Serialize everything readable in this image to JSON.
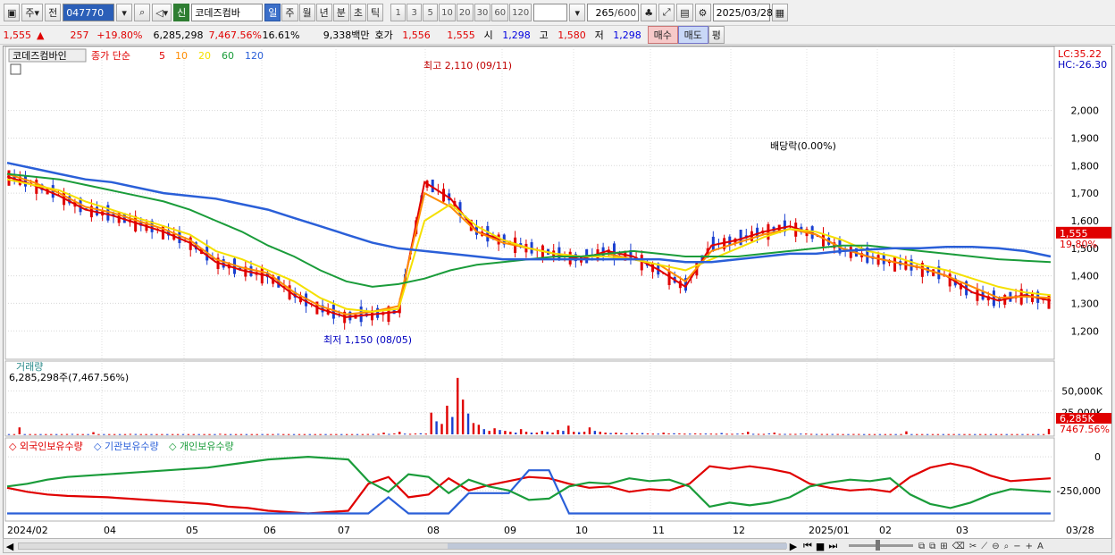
{
  "toolbar": {
    "period": "주",
    "prev_label": "전",
    "code": "047770",
    "shin": "신",
    "name": "코데즈컴바",
    "intervals": [
      "일",
      "주",
      "월",
      "년",
      "분",
      "초",
      "틱"
    ],
    "selected_interval": "일",
    "numbers": [
      "1",
      "3",
      "5",
      "10",
      "20",
      "30",
      "60",
      "120"
    ],
    "count": "265",
    "total": "/600",
    "date": "2025/03/28"
  },
  "quote": {
    "price": "1,555",
    "arrow": "▲",
    "change": "257",
    "change_pct": "+19.80%",
    "volume": "6,285,298",
    "vol_pct": "7,467.56%",
    "turnover": "16.61%",
    "amount": "9,338백만",
    "bid_label": "호가",
    "bid1": "1,556",
    "bid2": "1,555",
    "open_label": "시",
    "open": "1,298",
    "high_label": "고",
    "high": "1,580",
    "low_label": "저",
    "low": "1,298",
    "buy": "매수",
    "sell": "매도",
    "eval": "평"
  },
  "legend": {
    "name": "코데즈컴바인",
    "ma_label": "종가 단순",
    "ma": [
      {
        "label": "5",
        "color": "#e00000"
      },
      {
        "label": "10",
        "color": "#ff8c00"
      },
      {
        "label": "20",
        "color": "#f5e000"
      },
      {
        "label": "60",
        "color": "#1a9c3a"
      },
      {
        "label": "120",
        "color": "#2a5fd8"
      }
    ]
  },
  "annotations": {
    "high": "최고 2,110 (09/11)",
    "low": "최저 1,150 (08/05)",
    "dividend": "배당락(0.00%)",
    "lc": "LC:35.22",
    "hc": "HC:-26.30",
    "last_price": "1,555",
    "last_pct": "19.80%",
    "vol_last": "6,285K",
    "vol_last_pct": "7467.56%"
  },
  "volume_panel": {
    "title": "거래량",
    "value": "6,285,298주(7,467.56%)"
  },
  "holder_panel": {
    "series": [
      "외국인보유수량",
      "기관보유수량",
      "개인보유수량"
    ]
  },
  "colors": {
    "up": "#e00000",
    "down": "#1a3fd0",
    "foreign": "#e00000",
    "institution": "#2a5fd8",
    "individual": "#1a9c3a"
  },
  "chart_data": [
    {
      "type": "line",
      "title": "코데즈컴바인",
      "x": [
        "2024/02",
        "04",
        "05",
        "06",
        "07",
        "08",
        "09",
        "10",
        "11",
        "12",
        "2025/01",
        "02",
        "03",
        "03/28"
      ],
      "ylim": [
        1110,
        2200
      ],
      "yticks": [
        1200,
        1300,
        1400,
        1500,
        1600,
        1700,
        1800,
        1900,
        2000
      ],
      "series": [
        {
          "name": "5",
          "values": [
            1760,
            1730,
            1690,
            1640,
            1620,
            1590,
            1560,
            1520,
            1450,
            1420,
            1400,
            1330,
            1280,
            1250,
            1260,
            1270,
            1740,
            1680,
            1560,
            1530,
            1500,
            1480,
            1460,
            1490,
            1470,
            1420,
            1360,
            1510,
            1530,
            1560,
            1580,
            1550,
            1500,
            1470,
            1450,
            1430,
            1400,
            1340,
            1310,
            1330,
            1310
          ]
        },
        {
          "name": "10",
          "values": [
            1770,
            1740,
            1700,
            1650,
            1630,
            1600,
            1570,
            1530,
            1460,
            1430,
            1410,
            1340,
            1290,
            1260,
            1270,
            1290,
            1700,
            1650,
            1560,
            1520,
            1500,
            1480,
            1470,
            1480,
            1460,
            1440,
            1380,
            1490,
            1520,
            1550,
            1570,
            1550,
            1500,
            1470,
            1450,
            1430,
            1400,
            1360,
            1320,
            1325,
            1320
          ]
        },
        {
          "name": "20",
          "values": [
            1750,
            1730,
            1710,
            1670,
            1640,
            1610,
            1580,
            1550,
            1490,
            1460,
            1420,
            1380,
            1320,
            1280,
            1270,
            1280,
            1600,
            1660,
            1580,
            1530,
            1500,
            1480,
            1470,
            1470,
            1460,
            1440,
            1420,
            1460,
            1500,
            1540,
            1570,
            1560,
            1530,
            1490,
            1470,
            1440,
            1420,
            1390,
            1360,
            1340,
            1330
          ]
        },
        {
          "name": "60",
          "values": [
            1770,
            1760,
            1750,
            1730,
            1710,
            1690,
            1670,
            1640,
            1600,
            1560,
            1510,
            1470,
            1420,
            1380,
            1360,
            1370,
            1390,
            1420,
            1440,
            1450,
            1460,
            1470,
            1470,
            1480,
            1490,
            1480,
            1470,
            1470,
            1470,
            1480,
            1490,
            1500,
            1510,
            1510,
            1500,
            1490,
            1480,
            1470,
            1460,
            1455,
            1450
          ]
        },
        {
          "name": "120",
          "values": [
            1810,
            1790,
            1770,
            1750,
            1740,
            1720,
            1700,
            1690,
            1680,
            1660,
            1640,
            1610,
            1580,
            1550,
            1520,
            1500,
            1490,
            1480,
            1470,
            1460,
            1460,
            1460,
            1460,
            1460,
            1460,
            1460,
            1450,
            1450,
            1460,
            1470,
            1480,
            1480,
            1490,
            1495,
            1500,
            1500,
            1505,
            1505,
            1500,
            1490,
            1470
          ]
        }
      ]
    },
    {
      "type": "bar",
      "title": "거래량",
      "ylim": [
        0,
        70000
      ],
      "yticks": [
        25000,
        50000
      ],
      "values": [
        300,
        300,
        8000,
        300,
        300,
        300,
        300,
        300,
        300,
        300,
        300,
        400,
        500,
        300,
        300,
        300,
        2500,
        300,
        300,
        300,
        300,
        300,
        300,
        500,
        400,
        300,
        300,
        300,
        300,
        300,
        300,
        300,
        300,
        300,
        300,
        300,
        300,
        300,
        300,
        300,
        600,
        300,
        300,
        300,
        300,
        300,
        300,
        300,
        300,
        300,
        300,
        500,
        300,
        300,
        300,
        300,
        300,
        300,
        300,
        300,
        300,
        300,
        300,
        300,
        300,
        300,
        300,
        300,
        400,
        400,
        500,
        2000,
        500,
        1000,
        3000,
        800,
        600,
        900,
        1200,
        800,
        25000,
        15000,
        12000,
        33000,
        20000,
        65000,
        40000,
        24000,
        13000,
        11000,
        6000,
        4000,
        7000,
        5000,
        4000,
        3000,
        2000,
        6000,
        3000,
        2000,
        2000,
        4000,
        3000,
        2000,
        5000,
        4000,
        10000,
        3000,
        2500,
        3000,
        8000,
        4000,
        3000,
        2000,
        1500,
        2000,
        1500,
        1000,
        2000,
        1000,
        1500,
        1000,
        800,
        800,
        2000,
        1000,
        1200,
        1000,
        800,
        800,
        1000,
        800,
        900,
        800,
        700,
        1500,
        700,
        600,
        800,
        1200,
        3000,
        600,
        500,
        500,
        1000,
        2000,
        500,
        500,
        500,
        500,
        800,
        800,
        500,
        400,
        400,
        400,
        400,
        400,
        300,
        300,
        400,
        400,
        300,
        300,
        300,
        300,
        300,
        300,
        300,
        300,
        3500,
        300,
        300,
        300,
        300,
        300,
        300,
        300,
        300,
        300,
        300,
        300,
        300,
        300,
        300,
        300,
        300,
        300,
        300,
        300,
        300,
        300,
        300,
        300,
        300,
        300,
        300,
        6285
      ]
    },
    {
      "type": "line",
      "title": "보유수량",
      "ylim": [
        -450000,
        100000
      ],
      "yticks": [
        0,
        -250000
      ],
      "series": [
        {
          "name": "외국인보유수량",
          "values": [
            -230000,
            -260000,
            -280000,
            -290000,
            -295000,
            -300000,
            -310000,
            -320000,
            -330000,
            -340000,
            -350000,
            -370000,
            -380000,
            -400000,
            -410000,
            -420000,
            -410000,
            -400000,
            -200000,
            -150000,
            -300000,
            -280000,
            -160000,
            -250000,
            -210000,
            -180000,
            -150000,
            -160000,
            -200000,
            -230000,
            -220000,
            -260000,
            -240000,
            -250000,
            -200000,
            -70000,
            -90000,
            -70000,
            -90000,
            -120000,
            -200000,
            -230000,
            -250000,
            -240000,
            -260000,
            -150000,
            -80000,
            -50000,
            -80000,
            -140000,
            -180000,
            -170000,
            -160000
          ]
        },
        {
          "name": "기관보유수량",
          "values": [
            -420000,
            -420000,
            -420000,
            -420000,
            -420000,
            -420000,
            -420000,
            -420000,
            -420000,
            -420000,
            -420000,
            -420000,
            -420000,
            -420000,
            -420000,
            -420000,
            -420000,
            -420000,
            -420000,
            -300000,
            -420000,
            -420000,
            -420000,
            -270000,
            -270000,
            -270000,
            -100000,
            -100000,
            -420000,
            -420000,
            -420000,
            -420000,
            -420000,
            -420000,
            -420000,
            -420000,
            -420000,
            -420000,
            -420000,
            -420000,
            -420000,
            -420000,
            -420000,
            -420000,
            -420000,
            -420000,
            -420000,
            -420000,
            -420000,
            -420000,
            -420000,
            -420000,
            -420000
          ]
        },
        {
          "name": "개인보유수량",
          "values": [
            -220000,
            -200000,
            -170000,
            -150000,
            -140000,
            -130000,
            -120000,
            -110000,
            -100000,
            -90000,
            -80000,
            -60000,
            -40000,
            -20000,
            -10000,
            0,
            -10000,
            -20000,
            -180000,
            -260000,
            -130000,
            -150000,
            -270000,
            -170000,
            -220000,
            -250000,
            -320000,
            -310000,
            -220000,
            -190000,
            -200000,
            -160000,
            -180000,
            -170000,
            -220000,
            -370000,
            -340000,
            -360000,
            -340000,
            -300000,
            -220000,
            -190000,
            -170000,
            -180000,
            -160000,
            -280000,
            -350000,
            -380000,
            -340000,
            -280000,
            -240000,
            -250000,
            -260000
          ]
        }
      ]
    }
  ],
  "time_axis": {
    "labels": [
      "2024/02",
      "04",
      "05",
      "06",
      "07",
      "08",
      "09",
      "10",
      "11",
      "12",
      "2025/01",
      "02",
      "03",
      "03/28"
    ]
  }
}
